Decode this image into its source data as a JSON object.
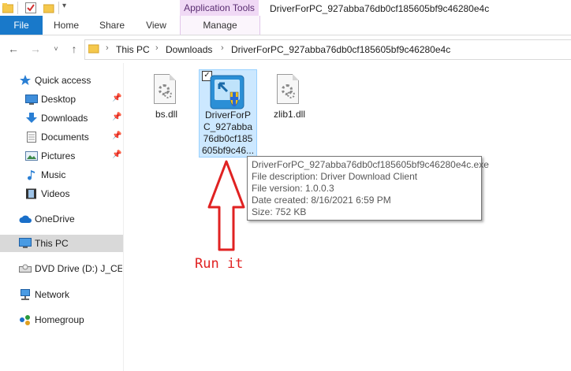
{
  "window": {
    "title": "DriverForPC_927abba76db0cf185605bf9c46280e4c",
    "contextual_group": "Application Tools"
  },
  "ribbon": {
    "file_tab": "File",
    "tabs": [
      "Home",
      "Share",
      "View"
    ],
    "contextual_tab": "Manage"
  },
  "address": {
    "crumbs": [
      "This PC",
      "Downloads",
      "DriverForPC_927abba76db0cf185605bf9c46280e4c"
    ]
  },
  "sidebar": {
    "items": [
      {
        "label": "Quick access",
        "icon": "star-icon",
        "pinned": false
      },
      {
        "label": "Desktop",
        "icon": "desktop-icon",
        "pinned": true
      },
      {
        "label": "Downloads",
        "icon": "download-arrow-icon",
        "pinned": true
      },
      {
        "label": "Documents",
        "icon": "documents-icon",
        "pinned": true
      },
      {
        "label": "Pictures",
        "icon": "pictures-icon",
        "pinned": true
      },
      {
        "label": "Music",
        "icon": "music-note-icon",
        "pinned": false
      },
      {
        "label": "Videos",
        "icon": "film-icon",
        "pinned": false
      },
      {
        "label": "OneDrive",
        "icon": "cloud-icon",
        "pinned": false
      },
      {
        "label": "This PC",
        "icon": "computer-icon",
        "pinned": false,
        "selected": true
      },
      {
        "label": "DVD Drive (D:) J_CENA_",
        "icon": "dvd-drive-icon",
        "pinned": false
      },
      {
        "label": "Network",
        "icon": "network-icon",
        "pinned": false
      },
      {
        "label": "Homegroup",
        "icon": "homegroup-icon",
        "pinned": false
      }
    ]
  },
  "files": [
    {
      "name": "bs.dll",
      "icon": "dll-file-icon"
    },
    {
      "name_lines": [
        "DriverForP",
        "C_927abba",
        "76db0cf185",
        "605bf9c46..."
      ],
      "icon": "installer-exe-icon",
      "selected": true
    },
    {
      "name": "zlib1.dll",
      "icon": "dll-file-icon"
    }
  ],
  "tooltip": {
    "lines": [
      "DriverForPC_927abba76db0cf185605bf9c46280e4c.exe",
      "File description: Driver Download Client",
      "File version: 1.0.0.3",
      "Date created: 8/16/2021 6:59 PM",
      "Size: 752 KB"
    ]
  },
  "annotation": {
    "text": "Run it",
    "color": "#e02222"
  },
  "colors": {
    "file_tab": "#1979ca",
    "contextual_band": "#f0d9f5",
    "selection": "#cce8ff",
    "sidebar_selected": "#d9d9d9"
  }
}
